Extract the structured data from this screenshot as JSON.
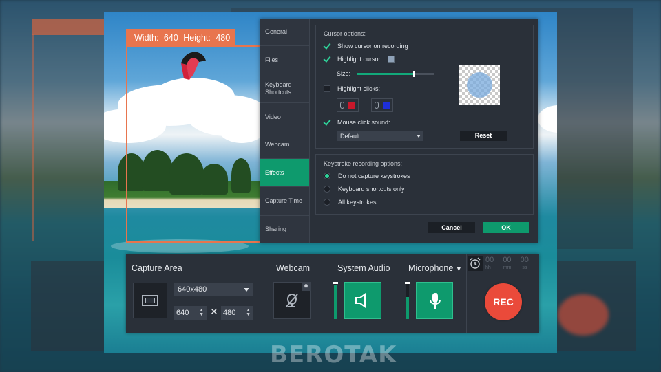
{
  "capture_label": {
    "width_label": "Width:",
    "width_value": "640",
    "height_label": "Height:",
    "height_value": "480"
  },
  "settings": {
    "nav": [
      {
        "label": "General",
        "active": false
      },
      {
        "label": "Files",
        "active": false
      },
      {
        "label": "Keyboard Shortcuts",
        "active": false
      },
      {
        "label": "Video",
        "active": false
      },
      {
        "label": "Webcam",
        "active": false
      },
      {
        "label": "Effects",
        "active": true
      },
      {
        "label": "Capture Time",
        "active": false
      },
      {
        "label": "Sharing",
        "active": false
      }
    ],
    "cursor_options": {
      "title": "Cursor options:",
      "show_cursor": {
        "label": "Show cursor on recording",
        "checked": true
      },
      "highlight_cursor": {
        "label": "Highlight cursor:",
        "checked": true
      },
      "size_label": "Size:",
      "size_value": 0.72,
      "highlight_clicks": {
        "label": "Highlight clicks:",
        "checked": false
      },
      "mouse_click_sound": {
        "label": "Mouse click sound:",
        "checked": true
      },
      "sound_select": "Default",
      "reset_button": "Reset"
    },
    "keystroke_options": {
      "title": "Keystroke recording options:",
      "options": [
        {
          "label": "Do not capture keystrokes",
          "selected": true
        },
        {
          "label": "Keyboard shortcuts only",
          "selected": false
        },
        {
          "label": "All keystrokes",
          "selected": false
        }
      ]
    },
    "cancel_button": "Cancel",
    "ok_button": "OK",
    "colors": {
      "accent": "#0e9a6d",
      "left_click": "#c9182b",
      "right_click": "#1e2fd8"
    }
  },
  "controls": {
    "capture_area": {
      "title": "Capture Area",
      "preset": "640x480",
      "width": "640",
      "times": "✕",
      "height": "480"
    },
    "webcam": {
      "title": "Webcam"
    },
    "system_audio": {
      "title": "System Audio",
      "level": 0.9
    },
    "microphone": {
      "title": "Microphone",
      "level": 0.6
    },
    "timer": {
      "hours": "00",
      "minutes": "00",
      "seconds": "00",
      "unit_h": "hh",
      "unit_m": "mm",
      "unit_s": "ss"
    },
    "rec_label": "REC",
    "rec_color": "#ea4a3a"
  },
  "watermark": "BEROTAK"
}
